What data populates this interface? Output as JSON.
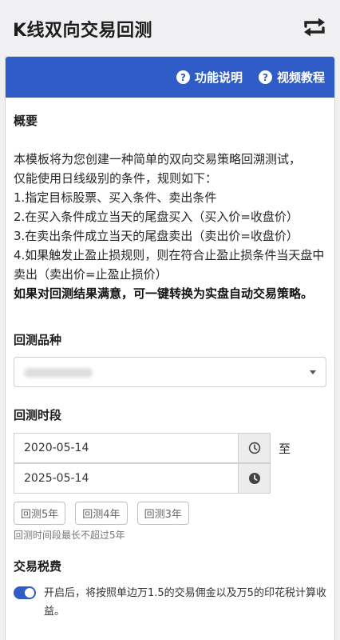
{
  "app": {
    "title": "K线双向交易回测",
    "switch_icon": "repeat-icon"
  },
  "header": {
    "help_label": "功能说明",
    "video_label": "视频教程",
    "accent": "#2f5cc7"
  },
  "overview": {
    "title": "概要",
    "lines": [
      "本模板将为您创建一种简单的双向交易策略回溯测试，",
      "仅能使用日线级别的条件，规则如下：",
      "1.指定目标股票、买入条件、卖出条件",
      "2.在买入条件成立当天的尾盘买入（买入价=收盘价）",
      "3.在卖出条件成立当天的尾盘卖出（卖出价=收盘价）",
      "4.如果触发止盈止损规则，则在符合止盈止损条件当天盘中卖出（卖出价=止盈止损价）"
    ],
    "bold_line": "如果对回测结果满意，可一键转换为实盘自动交易策略。"
  },
  "varieties": {
    "title": "回测品种"
  },
  "period": {
    "title": "回测时段",
    "start_date": "2020-05-14",
    "end_date": "2025-05-14",
    "to_label": "至",
    "quick_buttons": [
      "回测5年",
      "回测4年",
      "回测3年"
    ],
    "hint": "回测时间段最长不超过5年"
  },
  "tax": {
    "title": "交易税费",
    "enabled": true,
    "description": "开启后，将按照单边万1.5的交易佣金以及万5的印花税计算收益。"
  }
}
